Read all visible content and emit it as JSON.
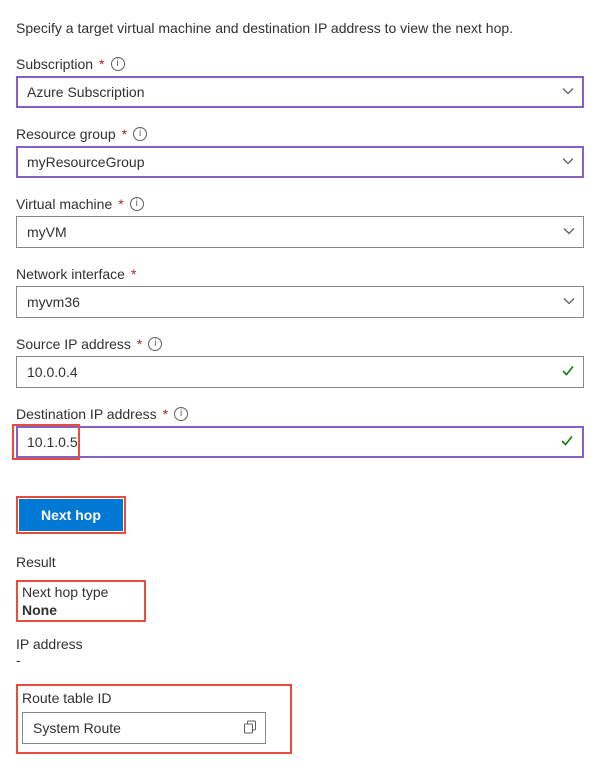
{
  "intro": "Specify a target virtual machine and destination IP address to view the next hop.",
  "fields": {
    "subscription": {
      "label": "Subscription",
      "value": "Azure Subscription"
    },
    "resource_group": {
      "label": "Resource group",
      "value": "myResourceGroup"
    },
    "virtual_machine": {
      "label": "Virtual machine",
      "value": "myVM"
    },
    "network_interface": {
      "label": "Network interface",
      "value": "myvm36"
    },
    "source_ip": {
      "label": "Source IP address",
      "value": "10.0.0.4"
    },
    "destination_ip": {
      "label": "Destination IP address",
      "value": "10.1.0.5"
    }
  },
  "button": {
    "next_hop": "Next hop"
  },
  "result": {
    "heading": "Result",
    "next_hop_type_label": "Next hop type",
    "next_hop_type_value": "None",
    "ip_address_label": "IP address",
    "ip_address_value": "-",
    "route_table_label": "Route table ID",
    "route_table_value": "System Route"
  },
  "required_mark": "*"
}
